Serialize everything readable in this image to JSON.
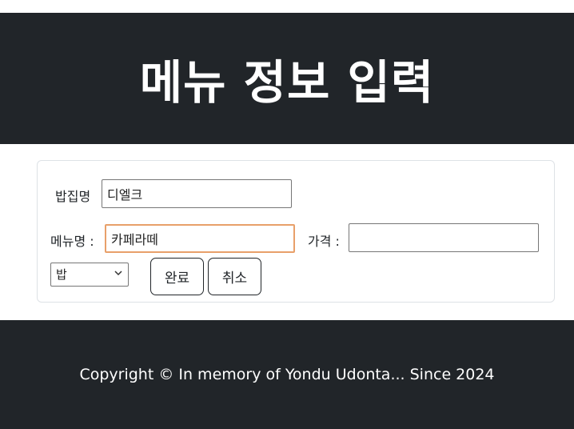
{
  "header": {
    "title": "메뉴 정보 입력"
  },
  "form": {
    "restaurant_label": "밥집명",
    "restaurant_value": "디엘크",
    "menu_label": "메뉴명 :",
    "menu_value": "카페라떼",
    "price_label": "가격 :",
    "price_value": "",
    "category_selected": "밥",
    "submit_label": "완료",
    "cancel_label": "취소"
  },
  "footer": {
    "copyright": "Copyright © In memory of Yondu Udonta... Since 2024"
  }
}
